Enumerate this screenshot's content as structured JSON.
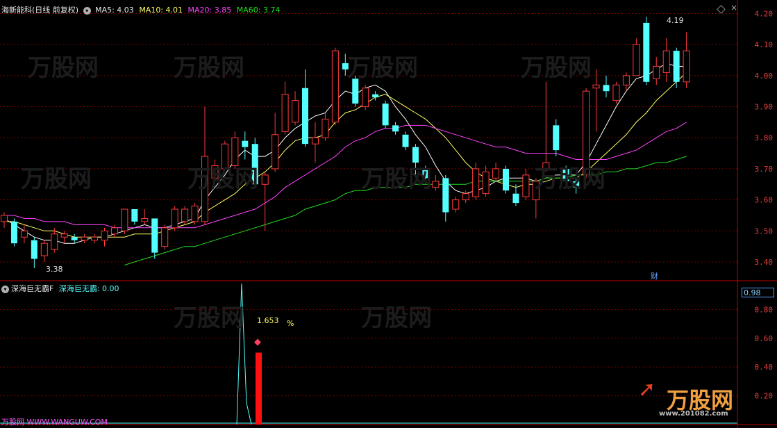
{
  "header": {
    "stock_name": "海新能科",
    "period": "(日线 前复权)",
    "ma5_label": "MA5: 4.03",
    "ma10_label": "MA10: 4.01",
    "ma20_label": "MA20: 3.85",
    "ma60_label": "MA60: 3.74"
  },
  "indicator": {
    "name": "深海巨无霸F",
    "value_label": "深海巨无霸: 0.00",
    "peak_text": "1.653",
    "unit_text": "%",
    "current_value": "0.98"
  },
  "annotations": {
    "high_label": "4.19",
    "low_label": "3.38",
    "finance_badge": "财"
  },
  "footer": {
    "site_link": "万股网 WWW.WANGUW.COM",
    "logo_text": "万股网",
    "logo_url": "www.201082.com"
  },
  "colors": {
    "up": "#ff3b3b",
    "down": "#54ffff",
    "ma5": "#ffffff",
    "ma10": "#ffff66",
    "ma20": "#ff44ff",
    "ma60": "#22dd22",
    "axis": "#c00000",
    "grid": "#7a0000"
  },
  "chart_data": {
    "type": "candlestick",
    "y_axis": [
      3.4,
      3.5,
      3.6,
      3.7,
      3.8,
      3.9,
      4.0,
      4.1,
      4.2
    ],
    "ylim": [
      3.35,
      4.225
    ],
    "candles": [
      [
        3.53,
        3.55,
        3.51,
        3.56
      ],
      [
        3.53,
        3.46,
        3.45,
        3.54
      ],
      [
        3.48,
        3.5,
        3.46,
        3.52
      ],
      [
        3.47,
        3.41,
        3.38,
        3.48
      ],
      [
        3.42,
        3.46,
        3.4,
        3.47
      ],
      [
        3.44,
        3.49,
        3.43,
        3.51
      ],
      [
        3.48,
        3.49,
        3.46,
        3.5
      ],
      [
        3.48,
        3.47,
        3.46,
        3.49
      ],
      [
        3.47,
        3.48,
        3.46,
        3.49
      ],
      [
        3.47,
        3.48,
        3.46,
        3.49
      ],
      [
        3.47,
        3.5,
        3.45,
        3.51
      ],
      [
        3.49,
        3.51,
        3.48,
        3.52
      ],
      [
        3.5,
        3.57,
        3.49,
        3.57
      ],
      [
        3.57,
        3.53,
        3.52,
        3.57
      ],
      [
        3.53,
        3.54,
        3.52,
        3.57
      ],
      [
        3.54,
        3.43,
        3.41,
        3.54
      ],
      [
        3.45,
        3.51,
        3.44,
        3.52
      ],
      [
        3.51,
        3.57,
        3.5,
        3.58
      ],
      [
        3.53,
        3.57,
        3.52,
        3.58
      ],
      [
        3.53,
        3.58,
        3.52,
        3.59
      ],
      [
        3.53,
        3.74,
        3.52,
        3.9
      ],
      [
        3.67,
        3.71,
        3.66,
        3.73
      ],
      [
        3.7,
        3.78,
        3.69,
        3.79
      ],
      [
        3.71,
        3.8,
        3.7,
        3.82
      ],
      [
        3.79,
        3.77,
        3.73,
        3.82
      ],
      [
        3.78,
        3.65,
        3.64,
        3.8
      ],
      [
        3.65,
        3.68,
        3.5,
        3.69
      ],
      [
        3.7,
        3.81,
        3.69,
        3.88
      ],
      [
        3.82,
        3.94,
        3.81,
        3.98
      ],
      [
        3.85,
        3.92,
        3.84,
        3.95
      ],
      [
        3.96,
        3.78,
        3.77,
        4.02
      ],
      [
        3.78,
        3.8,
        3.72,
        3.85
      ],
      [
        3.8,
        3.86,
        3.79,
        3.88
      ],
      [
        3.85,
        4.08,
        3.84,
        4.09
      ],
      [
        4.04,
        4.02,
        4.0,
        4.07
      ],
      [
        3.99,
        3.91,
        3.9,
        4.0
      ],
      [
        3.9,
        3.96,
        3.89,
        3.97
      ],
      [
        3.94,
        3.93,
        3.92,
        3.95
      ],
      [
        3.91,
        3.84,
        3.83,
        3.92
      ],
      [
        3.84,
        3.82,
        3.81,
        3.85
      ],
      [
        3.81,
        3.77,
        3.76,
        3.82
      ],
      [
        3.77,
        3.72,
        3.68,
        3.78
      ],
      [
        3.7,
        3.67,
        3.66,
        3.71
      ],
      [
        3.64,
        3.66,
        3.63,
        3.68
      ],
      [
        3.67,
        3.56,
        3.53,
        3.68
      ],
      [
        3.57,
        3.6,
        3.56,
        3.61
      ],
      [
        3.6,
        3.62,
        3.59,
        3.63
      ],
      [
        3.61,
        3.7,
        3.6,
        3.72
      ],
      [
        3.62,
        3.69,
        3.61,
        3.71
      ],
      [
        3.67,
        3.7,
        3.66,
        3.72
      ],
      [
        3.7,
        3.63,
        3.62,
        3.71
      ],
      [
        3.62,
        3.59,
        3.58,
        3.65
      ],
      [
        3.61,
        3.68,
        3.6,
        3.7
      ],
      [
        3.6,
        3.66,
        3.54,
        3.67
      ],
      [
        3.7,
        3.72,
        3.69,
        3.98
      ],
      [
        3.84,
        3.76,
        3.74,
        3.86
      ],
      [
        3.7,
        3.66,
        3.65,
        3.71
      ],
      [
        3.66,
        3.64,
        3.62,
        3.67
      ],
      [
        3.68,
        3.95,
        3.67,
        3.96
      ],
      [
        3.96,
        3.97,
        3.82,
        4.02
      ],
      [
        3.97,
        3.95,
        3.93,
        4.0
      ],
      [
        3.92,
        3.97,
        3.91,
        3.98
      ],
      [
        3.97,
        4.0,
        3.95,
        4.01
      ],
      [
        4.0,
        4.1,
        4.0,
        4.12
      ],
      [
        4.17,
        3.98,
        3.97,
        4.19
      ],
      [
        3.99,
        4.03,
        3.97,
        4.06
      ],
      [
        4.01,
        4.08,
        3.98,
        4.12
      ],
      [
        4.08,
        3.98,
        3.96,
        4.09
      ],
      [
        3.98,
        4.08,
        3.96,
        4.14
      ]
    ],
    "ma_series": [
      {
        "name": "MA5",
        "values": [
          3.54,
          3.52,
          3.5,
          3.48,
          3.47,
          3.47,
          3.46,
          3.46,
          3.47,
          3.48,
          3.48,
          3.49,
          3.5,
          3.51,
          3.52,
          3.51,
          3.51,
          3.52,
          3.53,
          3.54,
          3.6,
          3.64,
          3.68,
          3.73,
          3.76,
          3.74,
          3.74,
          3.76,
          3.8,
          3.83,
          3.85,
          3.87,
          3.88,
          3.92,
          3.95,
          3.94,
          3.96,
          3.97,
          3.95,
          3.9,
          3.86,
          3.81,
          3.77,
          3.71,
          3.66,
          3.63,
          3.62,
          3.63,
          3.64,
          3.66,
          3.67,
          3.67,
          3.67,
          3.66,
          3.67,
          3.68,
          3.68,
          3.68,
          3.72,
          3.78,
          3.84,
          3.9,
          3.95,
          3.99,
          4.0,
          4.02,
          4.04,
          4.03,
          4.03
        ]
      },
      {
        "name": "MA10",
        "values": [
          3.53,
          3.53,
          3.52,
          3.51,
          3.5,
          3.5,
          3.49,
          3.48,
          3.48,
          3.48,
          3.48,
          3.48,
          3.48,
          3.49,
          3.49,
          3.49,
          3.5,
          3.51,
          3.52,
          3.53,
          3.56,
          3.58,
          3.6,
          3.62,
          3.65,
          3.67,
          3.69,
          3.72,
          3.76,
          3.79,
          3.8,
          3.8,
          3.81,
          3.85,
          3.88,
          3.89,
          3.91,
          3.93,
          3.94,
          3.92,
          3.9,
          3.88,
          3.86,
          3.83,
          3.8,
          3.76,
          3.72,
          3.69,
          3.67,
          3.66,
          3.65,
          3.64,
          3.65,
          3.65,
          3.66,
          3.67,
          3.67,
          3.67,
          3.69,
          3.72,
          3.75,
          3.78,
          3.81,
          3.85,
          3.88,
          3.92,
          3.95,
          3.98,
          4.01
        ]
      },
      {
        "name": "MA20",
        "values": [
          3.55,
          3.55,
          3.54,
          3.54,
          3.53,
          3.53,
          3.53,
          3.52,
          3.52,
          3.52,
          3.52,
          3.51,
          3.51,
          3.51,
          3.51,
          3.51,
          3.51,
          3.51,
          3.51,
          3.51,
          3.52,
          3.53,
          3.54,
          3.55,
          3.56,
          3.57,
          3.59,
          3.61,
          3.64,
          3.66,
          3.68,
          3.7,
          3.72,
          3.74,
          3.77,
          3.79,
          3.8,
          3.82,
          3.83,
          3.83,
          3.84,
          3.84,
          3.84,
          3.83,
          3.82,
          3.81,
          3.8,
          3.79,
          3.78,
          3.77,
          3.77,
          3.76,
          3.75,
          3.75,
          3.75,
          3.75,
          3.74,
          3.73,
          3.73,
          3.73,
          3.73,
          3.74,
          3.75,
          3.76,
          3.78,
          3.8,
          3.82,
          3.83,
          3.85
        ]
      },
      {
        "name": "MA60",
        "values": [
          null,
          null,
          null,
          null,
          null,
          null,
          null,
          null,
          null,
          null,
          null,
          null,
          3.39,
          3.4,
          3.41,
          3.42,
          3.43,
          3.44,
          3.45,
          3.45,
          3.46,
          3.47,
          3.48,
          3.49,
          3.5,
          3.51,
          3.52,
          3.53,
          3.54,
          3.55,
          3.57,
          3.58,
          3.59,
          3.6,
          3.62,
          3.63,
          3.63,
          3.64,
          3.64,
          3.64,
          3.64,
          3.65,
          3.65,
          3.65,
          3.65,
          3.65,
          3.65,
          3.66,
          3.66,
          3.66,
          3.66,
          3.66,
          3.66,
          3.66,
          3.67,
          3.67,
          3.67,
          3.68,
          3.68,
          3.68,
          3.69,
          3.69,
          3.7,
          3.7,
          3.71,
          3.72,
          3.72,
          3.73,
          3.74
        ]
      }
    ],
    "indicator_axis": [
      0.2,
      0.4,
      0.6,
      0.8
    ],
    "indicator_ylim": [
      0,
      1.0
    ],
    "indicator_line": {
      "start_index": 21,
      "values": [
        0,
        0.98,
        0.15,
        0
      ]
    },
    "indicator_bar": {
      "index": 22,
      "value": 0.5
    }
  }
}
